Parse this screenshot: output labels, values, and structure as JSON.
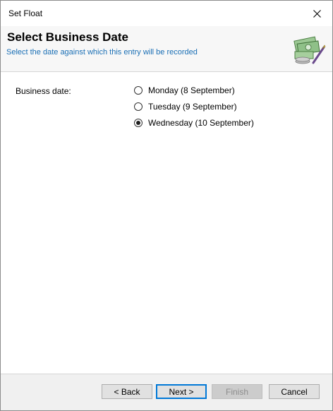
{
  "window": {
    "title": "Set Float"
  },
  "header": {
    "title": "Select Business Date",
    "subtitle": "Select the date against which this entry will be recorded",
    "icon": "money-icon"
  },
  "form": {
    "business_date_label": "Business date:",
    "options": [
      {
        "label": "Monday (8 September)",
        "selected": false
      },
      {
        "label": "Tuesday (9 September)",
        "selected": false
      },
      {
        "label": "Wednesday (10 September)",
        "selected": true
      }
    ]
  },
  "buttons": {
    "back": "< Back",
    "next": "Next >",
    "finish": "Finish",
    "cancel": "Cancel"
  },
  "colors": {
    "subtitle": "#1a6fb5",
    "default_button_border": "#0078d7"
  }
}
